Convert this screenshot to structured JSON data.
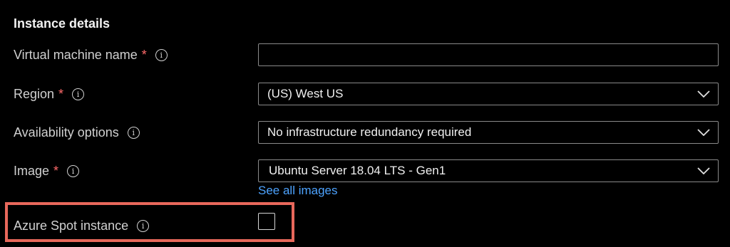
{
  "section": {
    "title": "Instance details"
  },
  "fields": {
    "vm_name": {
      "label": "Virtual machine name",
      "required": "*",
      "info": "i",
      "value": ""
    },
    "region": {
      "label": "Region",
      "required": "*",
      "info": "i",
      "value": "(US) West US"
    },
    "availability": {
      "label": "Availability options",
      "info": "i",
      "value": "No infrastructure redundancy required"
    },
    "image": {
      "label": "Image",
      "required": "*",
      "info": "i",
      "value": "Ubuntu Server 18.04 LTS - Gen1",
      "link": "See all images"
    },
    "spot": {
      "label": "Azure Spot instance",
      "info": "i",
      "checked": false
    }
  },
  "colors": {
    "background": "#000000",
    "required": "#ff6a6a",
    "link": "#4da3ff",
    "highlight": "#e8685b"
  },
  "icons": {
    "info": "info-icon",
    "dropdown": "chevron-down-icon"
  }
}
